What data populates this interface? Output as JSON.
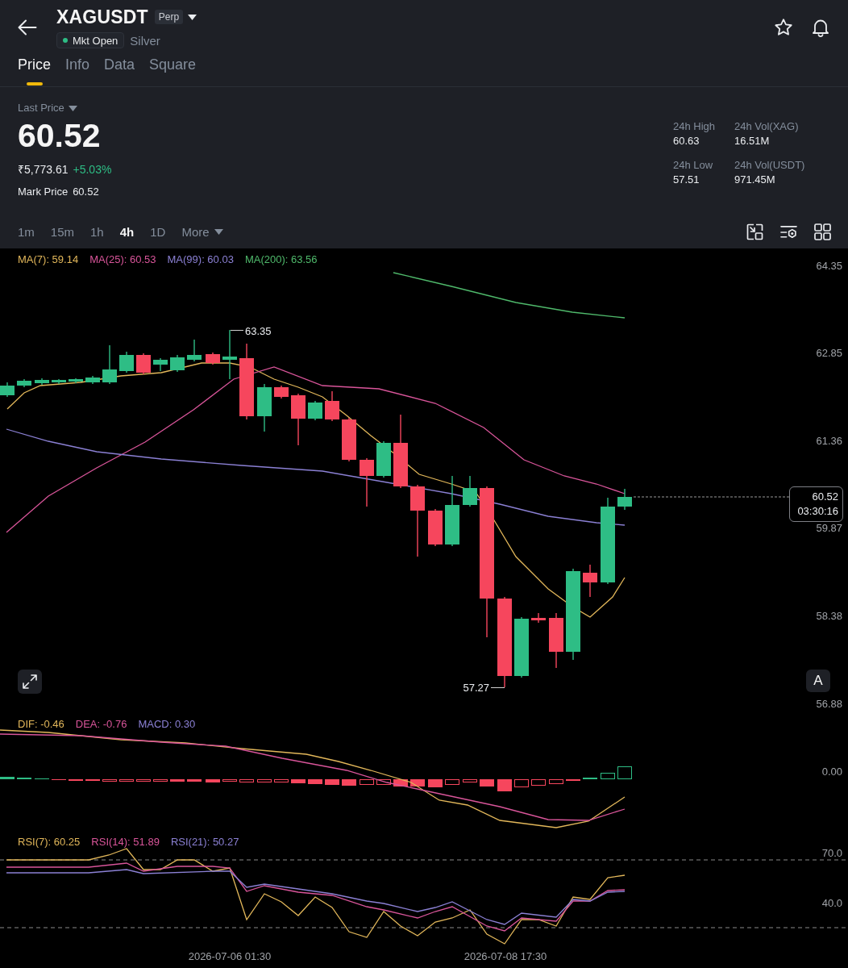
{
  "header": {
    "symbol": "XAGUSDT",
    "contract_type": "Perp",
    "market_status": "Mkt Open",
    "asset_name": "Silver"
  },
  "tabs": [
    {
      "label": "Price",
      "selected": true
    },
    {
      "label": "Info",
      "selected": false
    },
    {
      "label": "Data",
      "selected": false
    },
    {
      "label": "Square",
      "selected": false
    }
  ],
  "summary": {
    "price_type": "Last Price",
    "last_price": "60.52",
    "fiat_price": "₹5,773.61",
    "change": "+5.03%",
    "mark_price_label": "Mark Price",
    "mark_price": "60.52",
    "stats": [
      {
        "label": "24h High",
        "value": "60.63"
      },
      {
        "label": "24h Vol(XAG)",
        "value": "16.51M"
      },
      {
        "label": "24h Low",
        "value": "57.51"
      },
      {
        "label": "24h Vol(USDT)",
        "value": "971.45M"
      }
    ]
  },
  "intervals": [
    {
      "label": "1m",
      "selected": false,
      "kind": "interval"
    },
    {
      "label": "15m",
      "selected": false,
      "kind": "interval"
    },
    {
      "label": "1h",
      "selected": false,
      "kind": "interval"
    },
    {
      "label": "4h",
      "selected": true,
      "kind": "interval"
    },
    {
      "label": "1D",
      "selected": false,
      "kind": "interval"
    },
    {
      "label": "More",
      "selected": false,
      "kind": "menu"
    }
  ],
  "chart": {
    "moving_averages": [
      {
        "label": "MA(7): 59.14",
        "color": "#e2b75a"
      },
      {
        "label": "MA(25): 60.53",
        "color": "#d9559a"
      },
      {
        "label": "MA(99): 60.03",
        "color": "#8b80d4"
      },
      {
        "label": "MA(200): 63.56",
        "color": "#4fb96b"
      }
    ],
    "price_axis": [
      "64.35",
      "62.85",
      "61.36",
      "59.87",
      "58.38",
      "56.88"
    ],
    "high_label": "63.35",
    "low_label": "57.27",
    "price_tag": {
      "price": "60.52",
      "countdown": "03:30:16"
    },
    "auto_button": "A"
  },
  "macd": {
    "legend": [
      {
        "label": "DIF: -0.46",
        "color": "#e2b75a"
      },
      {
        "label": "DEA: -0.76",
        "color": "#d9559a"
      },
      {
        "label": "MACD: 0.30",
        "color": "#8b80d4"
      }
    ],
    "axis": [
      "0.00"
    ]
  },
  "rsi": {
    "legend": [
      {
        "label": "RSI(7): 60.25",
        "color": "#e2b75a"
      },
      {
        "label": "RSI(14): 51.89",
        "color": "#d9559a"
      },
      {
        "label": "RSI(21): 50.27",
        "color": "#8b80d4"
      }
    ],
    "axis": [
      "70.0",
      "40.0"
    ]
  },
  "time_axis": [
    "2026-07-06 01:30",
    "2026-07-08 17:30"
  ]
}
